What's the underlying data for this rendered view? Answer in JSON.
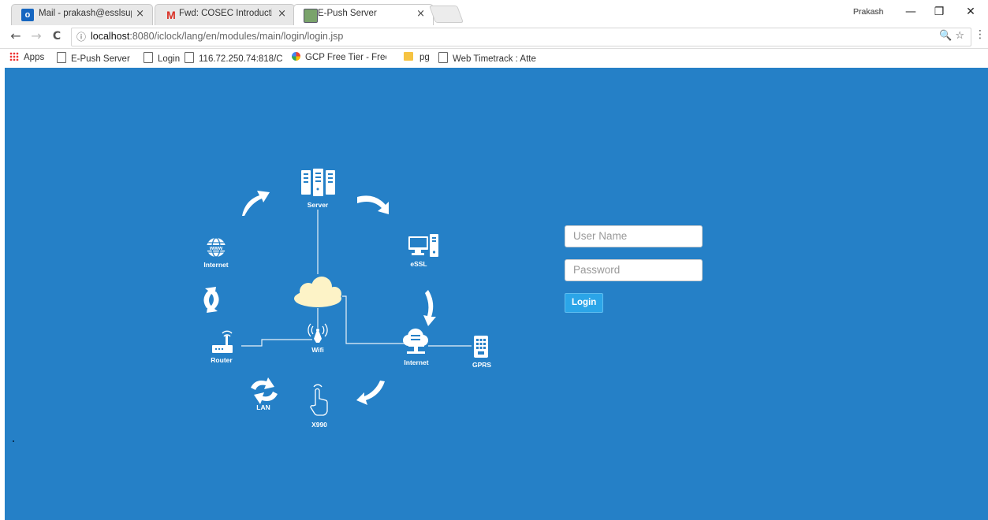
{
  "browser": {
    "tabs": [
      {
        "title": "Mail - prakash@esslsupp",
        "icon": "outlook-icon",
        "active": false
      },
      {
        "title": "Fwd: COSEC Introduction",
        "icon": "gmail-icon",
        "active": false
      },
      {
        "title": "E-Push Server",
        "icon": "epush-icon",
        "active": true
      }
    ],
    "tab_close": "×",
    "profile_name": "Prakash",
    "window_buttons": {
      "minimize": "—",
      "restore": "❐",
      "close": "✕"
    },
    "nav": {
      "back": "←",
      "forward": "→",
      "reload": "C"
    },
    "url": {
      "host": "localhost",
      "path": ":8080/iclock/lang/en/modules/main/login/login.jsp",
      "info_icon": "ⓘ"
    },
    "omnibox_right": "🔍 ☆",
    "menu": "⋮",
    "bookmarks": [
      {
        "label": "Apps",
        "icon": "apps-grid-icon"
      },
      {
        "label": "E-Push Server",
        "icon": "page-icon"
      },
      {
        "label": "Login",
        "icon": "page-icon"
      },
      {
        "label": "116.72.250.74:818/CC",
        "icon": "page-icon"
      },
      {
        "label": "GCP Free Tier - Free E",
        "icon": "gcp-icon"
      },
      {
        "label": "pg",
        "icon": "folder-icon"
      },
      {
        "label": "Web Timetrack : Atte",
        "icon": "page-icon"
      }
    ]
  },
  "diagram": {
    "labels": {
      "server": "Server",
      "essl": "eSSL",
      "internet_left": "Internet",
      "internet_right": "Internet",
      "router": "Router",
      "wifi": "Wifi",
      "gprs": "GPRS",
      "lan": "LAN",
      "x990": "X990"
    }
  },
  "login": {
    "username_placeholder": "User Name",
    "password_placeholder": "Password",
    "button_label": "Login"
  },
  "colors": {
    "page_bg": "#2580c7",
    "button_bg": "#2ba5e8",
    "icon_white": "#ffffff",
    "cloud": "#fdf3c7"
  }
}
